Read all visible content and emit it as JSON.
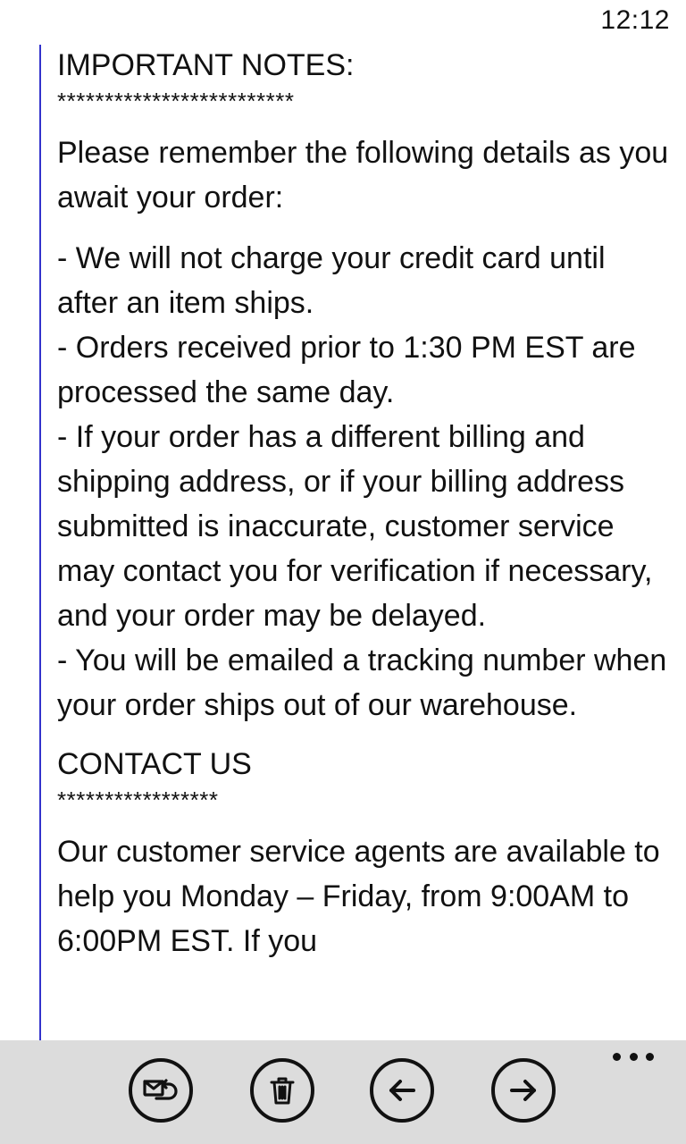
{
  "status_bar": {
    "time": "12:12"
  },
  "message": {
    "notes_heading": "IMPORTANT NOTES:",
    "notes_stars": "*************************",
    "intro": "Please remember the following details as you await your order:",
    "bullets": [
      "- We will not charge your credit card until after an item ships.",
      "- Orders received prior to 1:30 PM EST are processed the same day.",
      "- If your order has a different billing and shipping address, or if your billing address submitted is inaccurate, customer service may contact you for verification if necessary, and your order may be delayed.",
      "- You will be emailed a tracking number when your order ships out of our warehouse."
    ],
    "contact_heading": "CONTACT US",
    "contact_stars": "*****************",
    "contact_text": "Our customer service agents are available to help you Monday – Friday, from 9:00AM to 6:00PM EST. If you"
  },
  "app_bar": {
    "buttons": [
      {
        "name": "reply-button",
        "icon": "reply-icon"
      },
      {
        "name": "delete-button",
        "icon": "trash-icon"
      },
      {
        "name": "previous-button",
        "icon": "arrow-left-icon"
      },
      {
        "name": "next-button",
        "icon": "arrow-right-icon"
      }
    ],
    "more_icon": "ellipsis-icon"
  }
}
